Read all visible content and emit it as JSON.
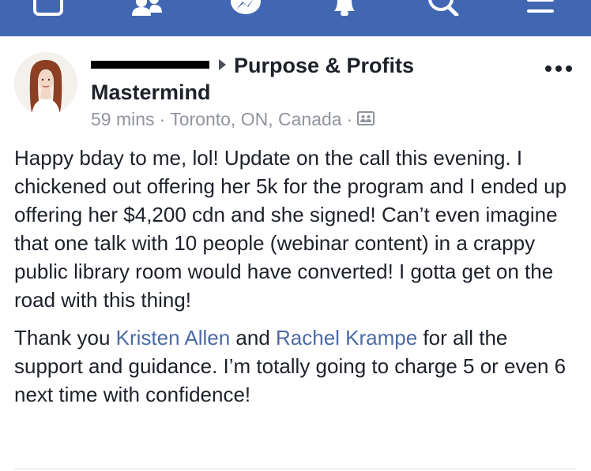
{
  "navbar": {
    "icons": [
      "home-icon",
      "friends-icon",
      "messenger-icon",
      "notifications-icon",
      "search-icon",
      "menu-icon"
    ],
    "background": "#4267b2"
  },
  "post": {
    "group_name_line1": "Purpose & Profits",
    "group_name_line2": "Mastermind",
    "time": "59 mins",
    "separator": "·",
    "location": "Toronto, ON, Canada",
    "privacy_icon": "group-privacy-icon",
    "paragraph1": "Happy bday to me, lol! Update on the call this evening. I chickened out offering her 5k for the program and I ended up offering her $4,200 cdn and she signed! Can’t even imagine that one talk with 10 people (webinar content) in a crappy public library room would have converted! I gotta get on the road with this thing!",
    "p2_start": "Thank you ",
    "mention1": "Kristen Allen",
    "p2_mid": " and ",
    "mention2": "Rachel Krampe",
    "p2_end": " for all the support and guidance. I’m totally going to charge 5 or even 6 next time with confidence!"
  },
  "colors": {
    "mention": "#4b6aa6",
    "meta": "#90949c",
    "text": "#1d2129"
  }
}
